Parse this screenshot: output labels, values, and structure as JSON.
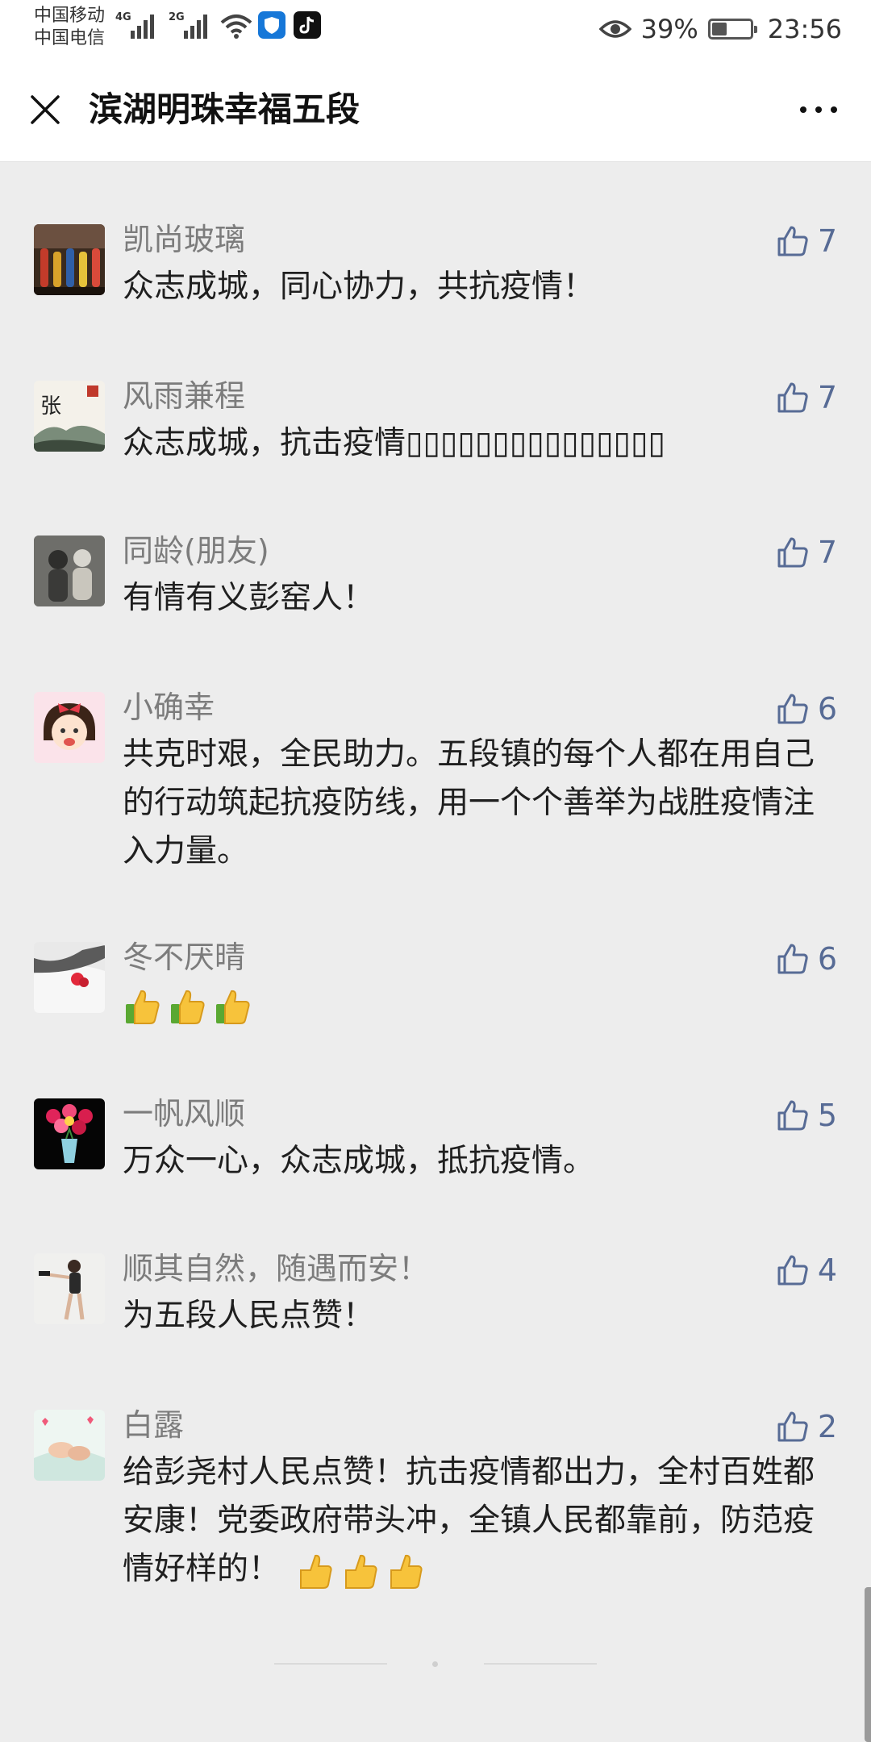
{
  "status_bar": {
    "carrier1": "中国移动",
    "carrier2": "中国电信",
    "net1": "4G",
    "net2": "2G",
    "battery_percent": "39%",
    "battery_level": 0.39,
    "time": "23:56"
  },
  "nav": {
    "title": "滨湖明珠幸福五段"
  },
  "comments": [
    {
      "nickname": "凯尚玻璃",
      "text": "众志成城，同心协力，共抗疫情！",
      "likes": "7"
    },
    {
      "nickname": "风雨兼程",
      "text": "众志成城，抗击疫情▯▯▯▯▯▯▯▯▯▯▯▯▯▯▯",
      "likes": "7"
    },
    {
      "nickname": "同龄(朋友)",
      "text": "有情有义彭窑人！",
      "likes": "7"
    },
    {
      "nickname": "小确幸",
      "text": "共克时艰，全民助力。五段镇的每个人都在用自己的行动筑起抗疫防线，用一个个善举为战胜疫情注入力量。",
      "likes": "6"
    },
    {
      "nickname": "冬不厌晴",
      "text": "",
      "likes": "6"
    },
    {
      "nickname": "一帆风顺",
      "text": "万众一心，众志成城，抵抗疫情。",
      "likes": "5"
    },
    {
      "nickname": "顺其自然，随遇而安！",
      "text": "为五段人民点赞！",
      "likes": "4"
    },
    {
      "nickname": "白露",
      "text": "给彭尧村人民点赞！抗击疫情都出力，全村百姓都安康！党委政府带头冲，全镇人民都靠前，防范疫情好样的！",
      "likes": "2"
    }
  ],
  "colors": {
    "background": "#EDEDED",
    "like_blue": "#576B95",
    "nickname_gray": "#7C7C7C"
  },
  "icons": {
    "close": "close-icon",
    "more": "more-icon",
    "like": "thumbs-up-icon",
    "eye": "eye-icon"
  }
}
